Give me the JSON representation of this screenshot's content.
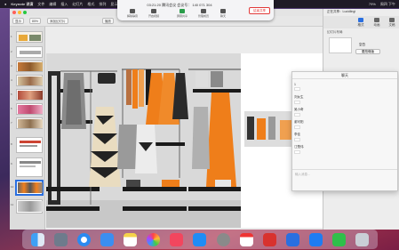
{
  "menubar": {
    "apple": "",
    "app_name": "Keynote 讲演",
    "items": [
      "文件",
      "编辑",
      "插入",
      "幻灯片",
      "格式",
      "排列",
      "显示",
      "播放",
      "窗口",
      "帮助"
    ],
    "right": [
      "79%",
      "周四 下午"
    ]
  },
  "meeting": {
    "timer": "03:21:20",
    "meeting_label": "腾讯会议 会议号：",
    "meeting_id": "140 071 304",
    "controls": [
      "解除静音",
      "开启视频",
      "屏幕共享",
      "管理成员",
      "聊天"
    ],
    "end_button": "结束共享"
  },
  "keynote": {
    "window_title": "Keynote 讲演",
    "toolbar": {
      "view": "显示",
      "zoom": "85%",
      "add_slide": "添加幻灯片",
      "play": "播放",
      "table": "表格",
      "chart": "图表",
      "text": "文本",
      "shape": "形状",
      "media": "媒体",
      "comment": "评论",
      "collaborate": "协作",
      "format": "格式",
      "animate": "动画",
      "document": "文稿"
    },
    "slides": [
      {
        "num": "1"
      },
      {
        "num": "2"
      },
      {
        "num": "3"
      },
      {
        "num": "4"
      },
      {
        "num": "5"
      },
      {
        "num": "6"
      },
      {
        "num": "7"
      },
      {
        "num": "8"
      },
      {
        "num": "9"
      },
      {
        "num": "10"
      },
      {
        "num": "11"
      }
    ],
    "selected_slide": "10"
  },
  "inspector": {
    "header": "正在共享：Lucidlingi",
    "tabs": [
      "格式",
      "动画",
      "文稿"
    ],
    "section_title": "幻灯片布局",
    "layout_label": "空白",
    "change_button": "更改母版"
  },
  "chat": {
    "title": "聊天",
    "messages": [
      {
        "from": "1"
      },
      {
        "from": "刘女生"
      },
      {
        "from": "吴小奇"
      },
      {
        "from": "谢可阳"
      },
      {
        "from": "李佳"
      },
      {
        "from": "江楚伟"
      }
    ],
    "input_placeholder": "输入消息..."
  },
  "dock": {
    "apps": [
      "finder-icon",
      "launchpad-icon",
      "safari-icon",
      "mail-icon",
      "notes-icon",
      "photos-icon",
      "music-icon",
      "appstore-icon",
      "settings-icon",
      "calendar-icon",
      "wps-icon",
      "keynote-icon",
      "tencent-meeting-icon",
      "wechat-icon",
      "trash-icon"
    ]
  },
  "colors": {
    "accent": "#2a6fe0",
    "end_share": "#e23b3b",
    "dress_orange": "#ef7e1a",
    "wall_grey": "#8f8f8f"
  }
}
